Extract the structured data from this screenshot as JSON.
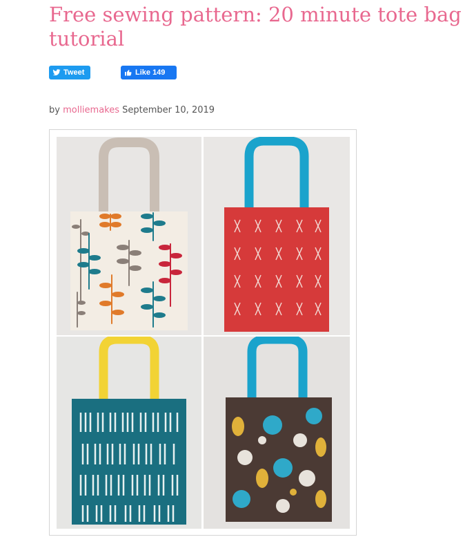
{
  "post": {
    "title": "Free sewing pattern: 20 minute tote bag tutorial",
    "byline_prefix": "by",
    "author": "molliemakes",
    "date": "September 10, 2019"
  },
  "social": {
    "tweet_label": "Tweet",
    "like_label": "Like 149"
  },
  "colors": {
    "accent": "#e8688f",
    "twitter": "#1d9bf0",
    "facebook": "#1877f2"
  },
  "icons": [
    "twitter-bird-icon",
    "thumbs-up-icon"
  ],
  "image": {
    "bags": [
      {
        "fabric": "cream with leaf fronds",
        "handle": "grey-beige"
      },
      {
        "fabric": "red with white crosses",
        "handle": "turquoise"
      },
      {
        "fabric": "teal with white stripes",
        "handle": "yellow"
      },
      {
        "fabric": "brown floral",
        "handle": "turquoise"
      }
    ]
  }
}
